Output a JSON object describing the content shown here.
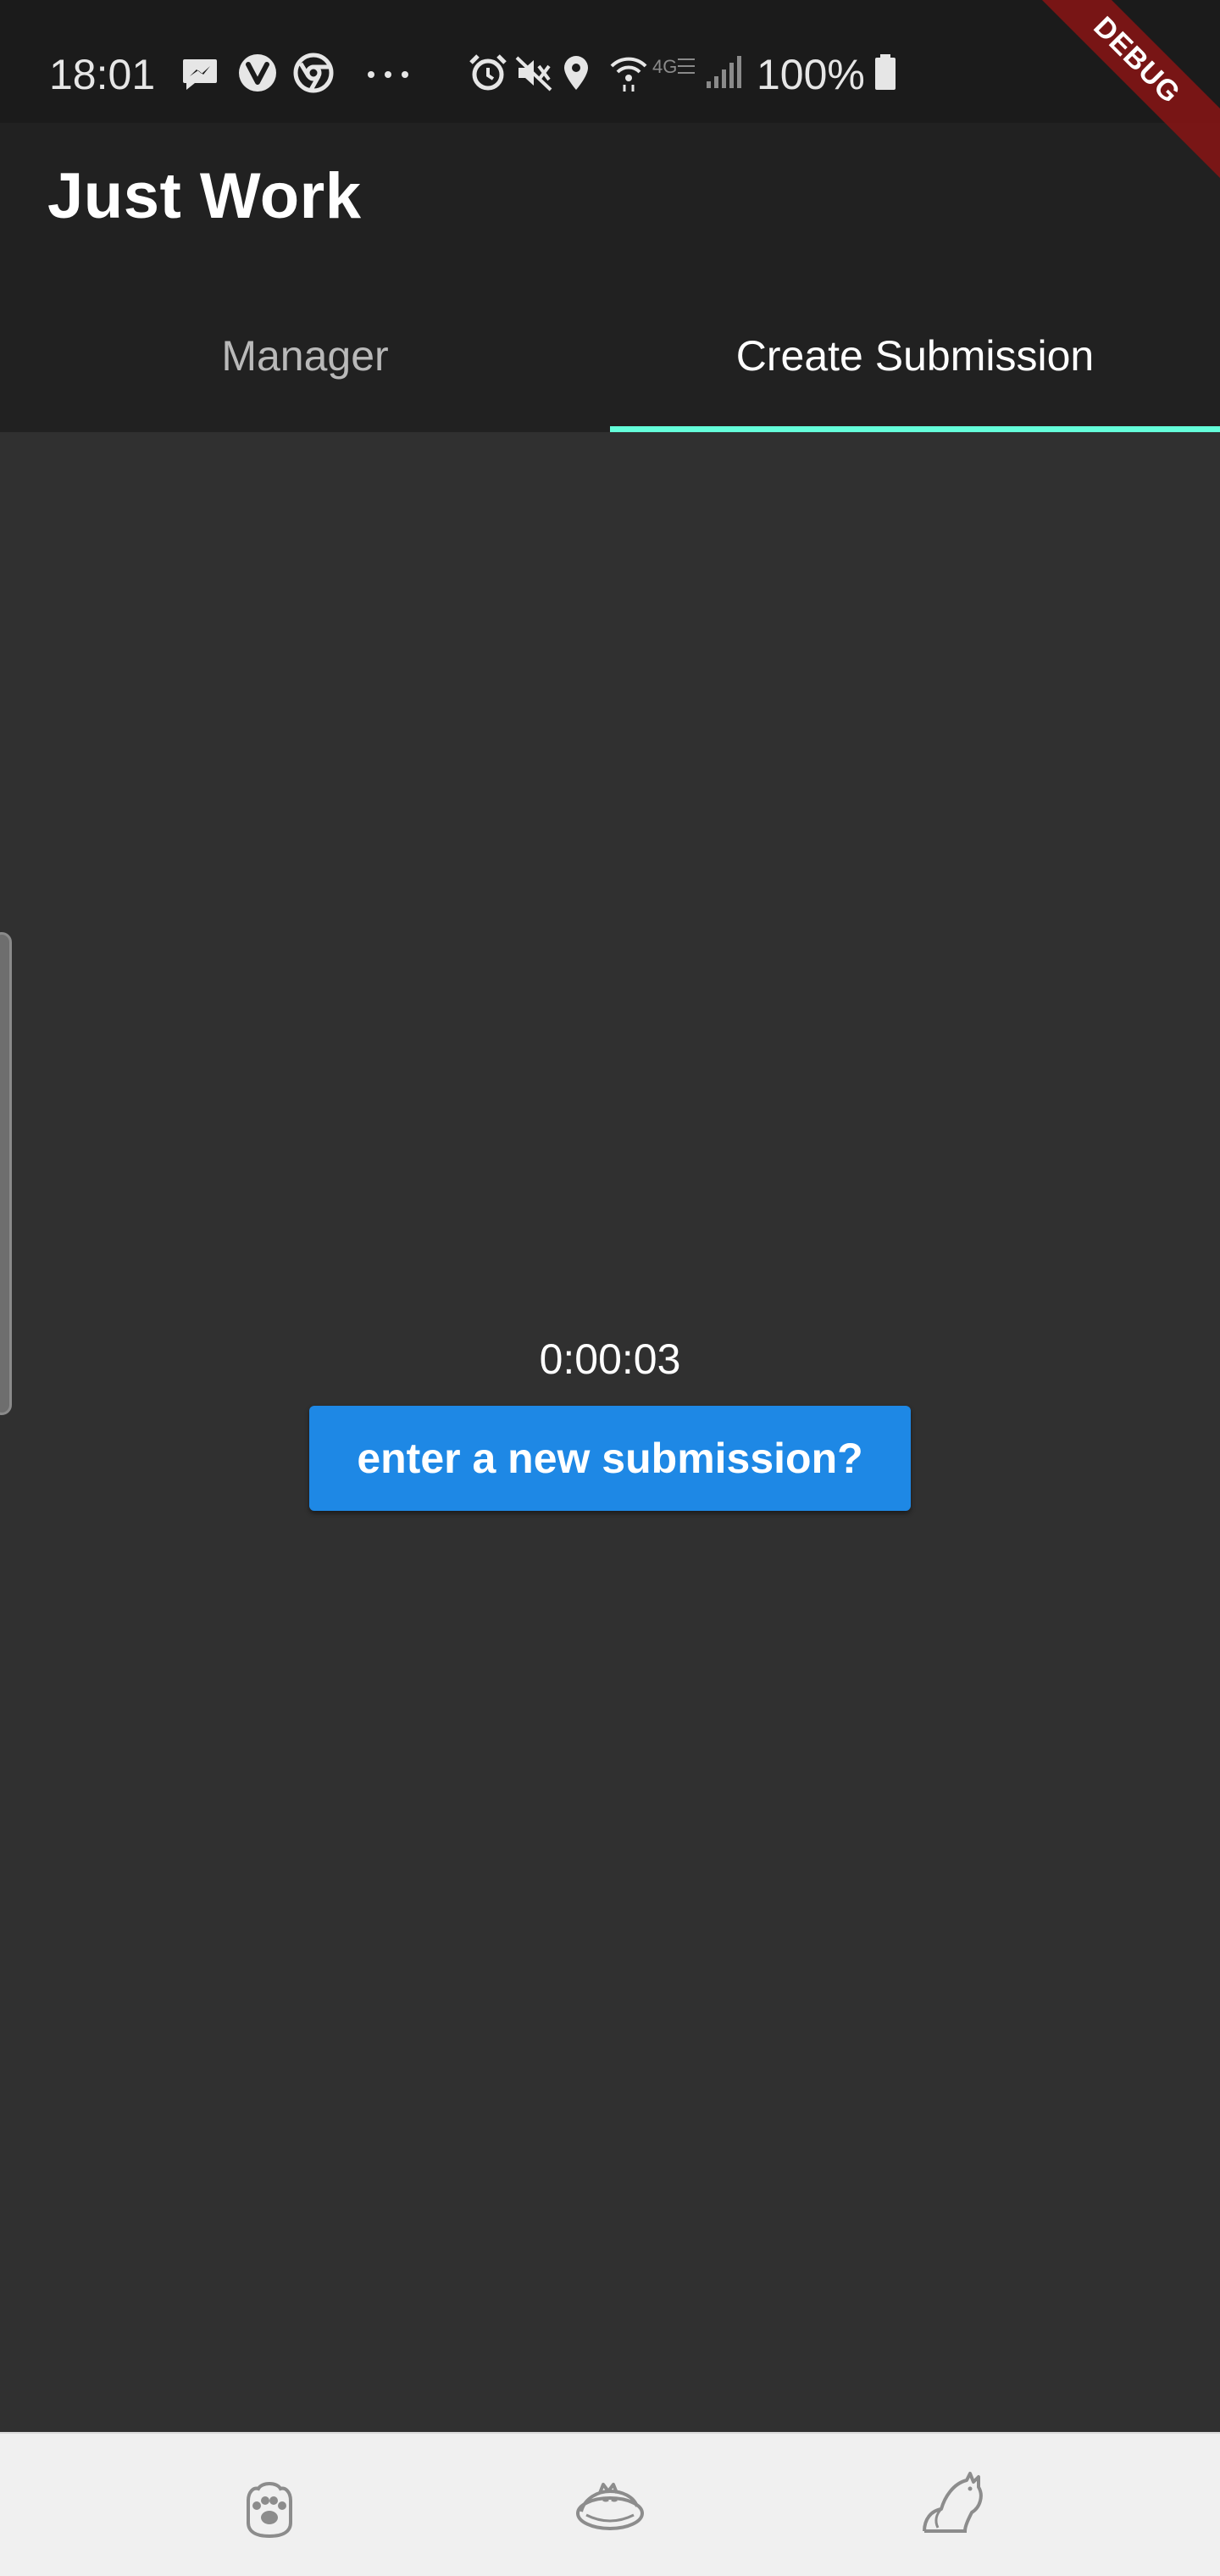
{
  "status_bar": {
    "time": "18:01",
    "battery_percent": "100%",
    "left_icons": [
      "messenger-icon",
      "vivaldi-icon",
      "chrome-icon",
      "more-dots-icon"
    ],
    "right_icons": [
      "alarm-icon",
      "mute-icon",
      "location-icon",
      "wifi-icon",
      "4g-icon",
      "signal-icon",
      "battery-icon"
    ],
    "network_label": "4G"
  },
  "app_bar": {
    "title": "Just Work"
  },
  "tabs": [
    {
      "label": "Manager",
      "active": false
    },
    {
      "label": "Create Submission",
      "active": true
    }
  ],
  "main": {
    "timer": "0:00:03",
    "new_submission_label": "enter a new submission?"
  },
  "bottom_nav": {
    "items": [
      "paw-icon",
      "sleeping-cat-icon",
      "stretching-cat-icon"
    ]
  },
  "debug_banner": "DEBUG",
  "colors": {
    "status_bar_bg": "#1b1b1b",
    "app_bar_bg": "#212121",
    "body_bg": "#303030",
    "tab_indicator": "#64ffda",
    "button_bg": "#1e88e5",
    "bottom_nav_bg": "#f0f0f0",
    "debug_banner": "#881414"
  }
}
